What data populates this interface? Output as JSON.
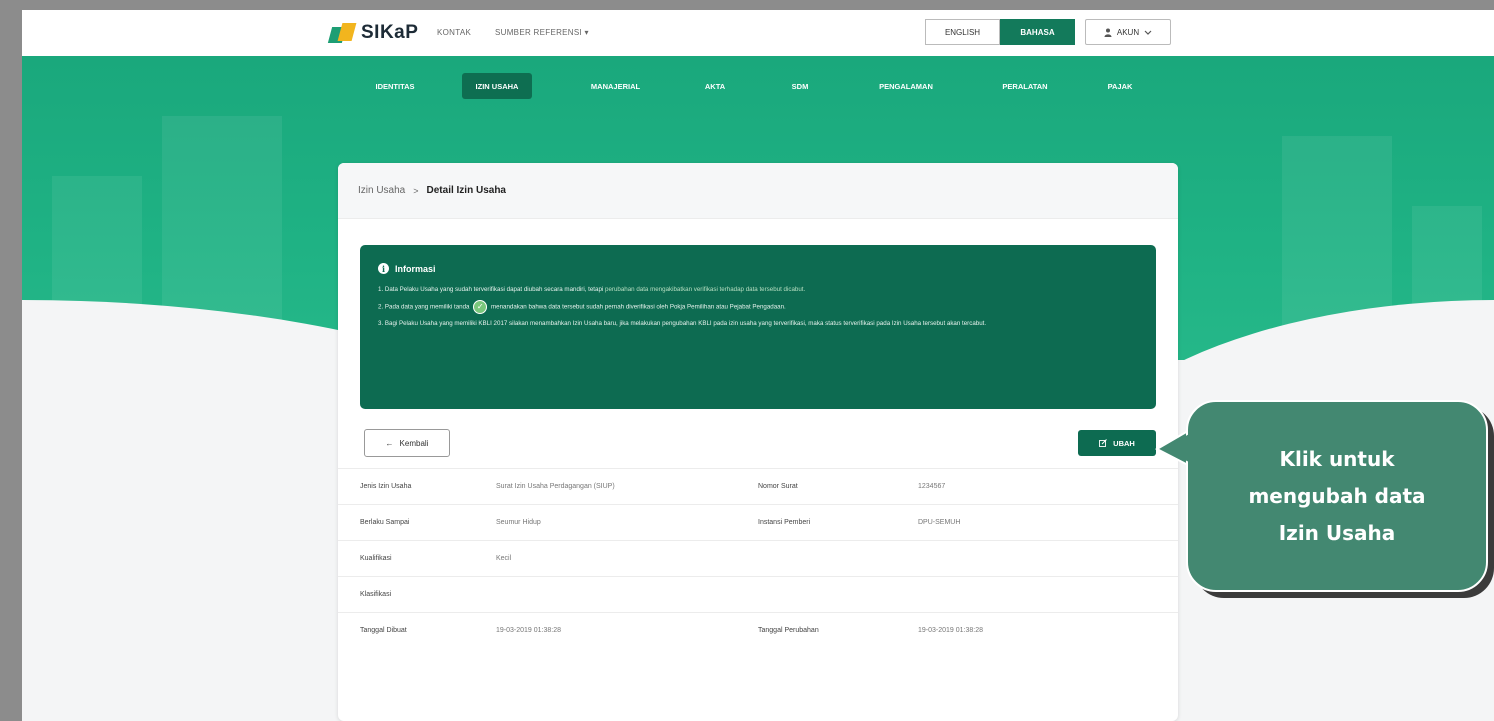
{
  "header": {
    "logo_text": "SIKaP",
    "nav": [
      "KONTAK",
      "SUMBER REFERENSI ▾"
    ],
    "lang_en": "ENGLISH",
    "lang_id": "BAHASA",
    "account": "AKUN"
  },
  "tabs": [
    {
      "label": "IDENTITAS",
      "active": false
    },
    {
      "label": "IZIN USAHA",
      "active": true
    },
    {
      "label": "MANAJERIAL",
      "active": false
    },
    {
      "label": "AKTA",
      "active": false
    },
    {
      "label": "SDM",
      "active": false
    },
    {
      "label": "PENGALAMAN",
      "active": false
    },
    {
      "label": "PERALATAN",
      "active": false
    },
    {
      "label": "PAJAK",
      "active": false
    }
  ],
  "breadcrumb": {
    "root": "Izin Usaha",
    "separator": ">",
    "current": "Detail Izin Usaha"
  },
  "info": {
    "title": "Informasi",
    "line1_prefix": "1. Data Pelaku Usaha yang sudah terverifikasi dapat diubah secara mandiri, tetapi ",
    "line1_link": "perubahan data mengakibatkan verifikasi terhadap data tersebut dicabut.",
    "line2_prefix": "2. Pada data yang memiliki tanda",
    "line2_suffix": "menandakan bahwa data tersebut sudah pernah diverifikasi oleh Pokja Pemilihan atau Pejabat Pengadaan.",
    "line3": "3. Bagi Pelaku Usaha yang memiliki KBLI 2017 silakan menambahkan Izin Usaha baru, jika melakukan pengubahan KBLI pada izin usaha yang terverifikasi, maka status terverifikasi pada Izin Usaha tersebut akan tercabut."
  },
  "actions": {
    "back_label": "Kembali",
    "edit_label": "UBAH"
  },
  "details": [
    {
      "label1": "Jenis Izin Usaha",
      "value1": "Surat Izin Usaha Perdagangan (SIUP)",
      "label2": "Nomor Surat",
      "value2": "1234567"
    },
    {
      "label1": "Berlaku Sampai",
      "value1": "Seumur Hidup",
      "label2": "Instansi Pemberi",
      "value2": "DPU-SEMUH"
    },
    {
      "label1": "Kualifikasi",
      "value1": "Kecil",
      "label2": "",
      "value2": ""
    },
    {
      "label1": "Klasifikasi",
      "value1": "",
      "label2": "",
      "value2": ""
    },
    {
      "label1": "Tanggal Dibuat",
      "value1": "19-03-2019 01:38:28",
      "label2": "Tanggal Perubahan",
      "value2": "19-03-2019 01:38:28"
    }
  ],
  "callout": {
    "lines": [
      "Klik untuk",
      "mengubah data",
      "Izin Usaha"
    ]
  },
  "colors": {
    "brand_green": "#1fb284",
    "dark_green": "#0d6b51",
    "callout_green": "#438871"
  }
}
